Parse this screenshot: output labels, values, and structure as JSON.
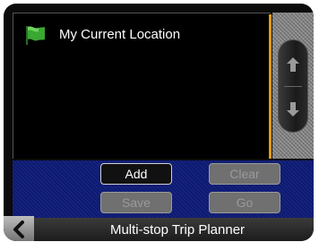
{
  "locations": {
    "items": [
      {
        "label": "My Current Location",
        "icon": "green-flag-icon"
      }
    ]
  },
  "scroll": {
    "up_icon": "arrow-up-icon",
    "down_icon": "arrow-down-icon"
  },
  "buttons": {
    "add": "Add",
    "clear": "Clear",
    "save": "Save",
    "go": "Go"
  },
  "footer": {
    "title": "Multi-stop Trip Planner",
    "back_icon": "chevron-left-icon"
  },
  "colors": {
    "list_bg": "#000000",
    "control_bar": "#0d1a73",
    "divider": "#e39a12",
    "flag": "#3aa832"
  }
}
